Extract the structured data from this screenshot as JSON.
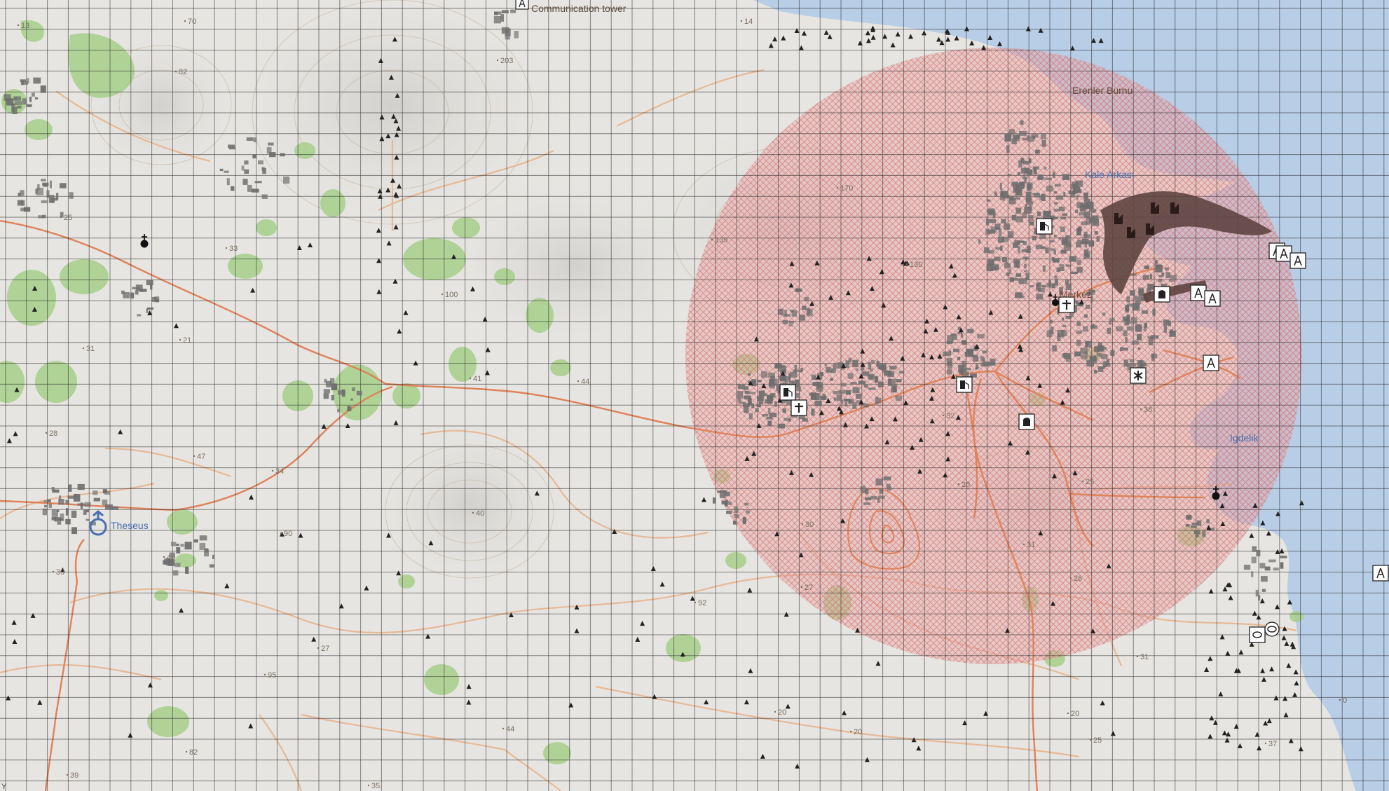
{
  "map": {
    "labels": {
      "communication_tower": "Communication tower",
      "erenler_burnu": "Erenler Burnu",
      "kale_arkasi": "Kale Arkası",
      "igdelik": "Igdelik",
      "theseus": "Theseus",
      "merkez": "Merkez"
    },
    "spot_heights": [
      "13",
      "70",
      "82",
      "203",
      "14",
      "25",
      "33",
      "31",
      "21",
      "100",
      "41",
      "44",
      "139",
      "170",
      "130",
      "28",
      "47",
      "34",
      "40",
      "90",
      "40",
      "39",
      "30",
      "27",
      "95",
      "92",
      "27",
      "20",
      "44",
      "82",
      "35",
      "39",
      "37",
      "25",
      "31",
      "26",
      "32",
      "26",
      "36",
      "31",
      "25",
      "20",
      "20",
      "0"
    ],
    "corner_marker": "Y",
    "colors": {
      "land": "#e6e5e1",
      "sea": "#b8cde6",
      "zone_fill": "#e9a4a4",
      "zone_hatch": "#c96060",
      "road_main": "#e0825a",
      "road_minor": "#e6b58f",
      "forest": "#a6cf8a",
      "building": "#6d6d6d",
      "grid": "#2a2a2a"
    },
    "icons": [
      "communication-tower-icon",
      "church-icon",
      "fuel-station-icon",
      "hospital-icon",
      "lighthouse-icon",
      "transmitter-icon",
      "factory-icon",
      "fountain-icon",
      "police-icon"
    ]
  }
}
